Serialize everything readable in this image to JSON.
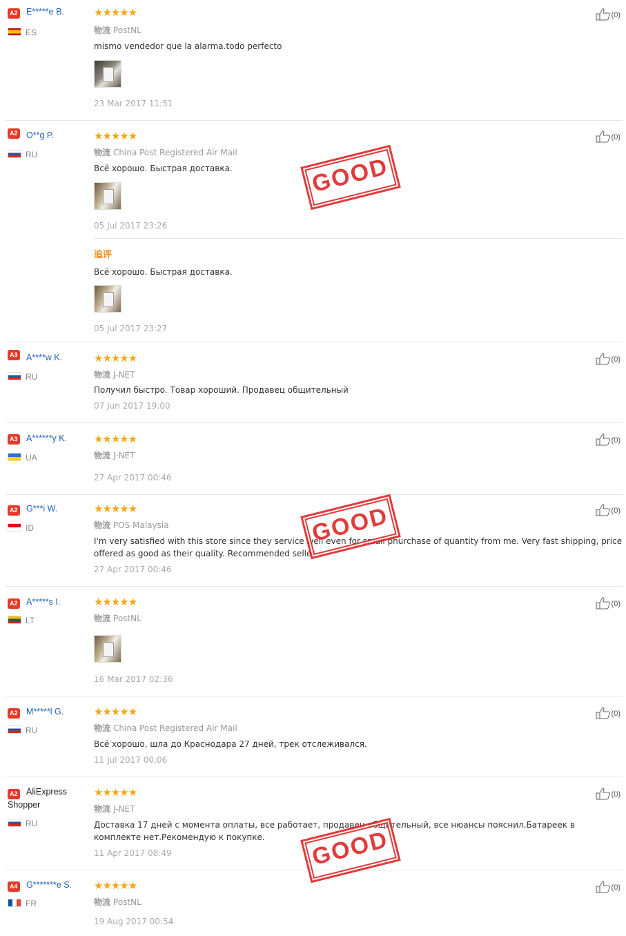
{
  "colors": {
    "username": "#1e63b6",
    "star": "#f7a612",
    "appended": "#f08a1a",
    "stamp": "#d22222"
  },
  "ship_label": "物流",
  "stamp_text": "GOOD",
  "reviews": [
    {
      "badge": "A2",
      "name": "E*****e B.",
      "country": "ES",
      "stars": "★★★★★",
      "shipping": "PostNL",
      "text": "mismo vendedor que la alarma.todo perfecto",
      "date": "23 Mar 2017 11:51",
      "likes": "(0)"
    },
    {
      "badge": "A2",
      "name": "O**g P.",
      "country": "RU",
      "stars": "★★★★★",
      "shipping": "China Post Registered Air Mail",
      "text": "Всё хорошо. Быстрая доставка.",
      "date": "05 Jul 2017 23:26",
      "likes": "(0)",
      "appended_label": "追评",
      "appended_text": "Всё хорошо. Быстрая доставка.",
      "appended_date": "05 Jul 2017 23:27"
    },
    {
      "badge": "A3",
      "name": "A****w K.",
      "country": "RU",
      "stars": "★★★★★",
      "shipping": "J-NET",
      "text": "Получил быстро. Товар хороший. Продавец общительный",
      "date": "07 Jun 2017 19:00",
      "likes": "(0)"
    },
    {
      "badge": "A3",
      "name": "A******y K.",
      "country": "UA",
      "stars": "★★★★★",
      "shipping": "J-NET",
      "date": "27 Apr 2017 00:46",
      "likes": "(0)"
    },
    {
      "badge": "A2",
      "name": "G***i W.",
      "country": "ID",
      "stars": "★★★★★",
      "shipping": "POS Malaysia",
      "text": "I'm very satisfied with this store since they service well even for small phurchase of quantity from me. Very fast shipping, price offered as good as their quality. Recommended seller",
      "date": "27 Apr 2017 00:46",
      "likes": "(0)"
    },
    {
      "badge": "A2",
      "name": "A*****s I.",
      "country": "LT",
      "stars": "★★★★★",
      "shipping": "PostNL",
      "date": "16 Mar 2017 02:36",
      "likes": "(0)"
    },
    {
      "badge": "A2",
      "name": "M*****l G.",
      "country": "RU",
      "stars": "★★★★★",
      "shipping": "China Post Registered Air Mail",
      "text": "Всё хорошо, шла до Краснодара 27 дней, трек отслеживался.",
      "date": "11 Jul 2017 00:06",
      "likes": "(0)"
    },
    {
      "badge": "A2",
      "name": "AliExpress Shopper",
      "country": "RU",
      "stars": "★★★★★",
      "shipping": "J-NET",
      "text": "Доставка 17 дней с момента оплаты, все работает, продавец общительный, все нюансы пояснил.Батареек в комплекте нет.Рекомендую к покупке.",
      "date": "11 Apr 2017 08:49",
      "likes": "(0)"
    },
    {
      "badge": "A4",
      "name": "G*******e S.",
      "country": "FR",
      "stars": "★★★★★",
      "shipping": "PostNL",
      "date": "19 Aug 2017 00:54",
      "likes": "(0)"
    }
  ]
}
